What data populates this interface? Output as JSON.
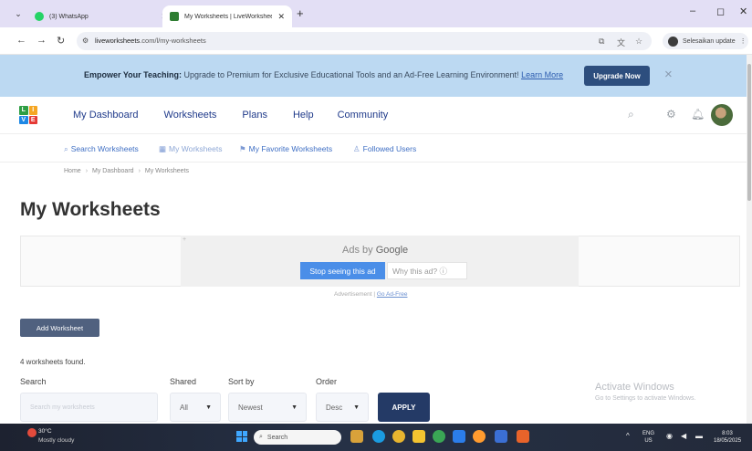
{
  "browser": {
    "tabs": [
      {
        "title": "(3) WhatsApp",
        "favicon_color": "#25d366",
        "active": false
      },
      {
        "title": "My Worksheets | LiveWorkshee",
        "favicon_color": "#2e7d32",
        "active": true
      }
    ],
    "new_tab": "+",
    "url_host": "liveworksheets",
    "url_rest": ".com/l/my-worksheets",
    "update_label": "Selesaikan update"
  },
  "promo": {
    "lead": "Empower Your Teaching:",
    "text": "Upgrade to Premium for Exclusive Educational Tools and an Ad-Free Learning Environment!",
    "learn_more": "Learn More",
    "button": "Upgrade Now",
    "close": "×"
  },
  "logo": {
    "letters": [
      "L",
      "I",
      "V",
      "E"
    ],
    "colors": [
      "#2e9e44",
      "#f5a623",
      "#1e88e5",
      "#e53935"
    ]
  },
  "nav": {
    "dashboard": "My Dashboard",
    "worksheets": "Worksheets",
    "plans": "Plans",
    "help": "Help",
    "community": "Community"
  },
  "subnav": {
    "search": "Search Worksheets",
    "mine": "My Worksheets",
    "favorites": "My Favorite Worksheets",
    "followed": "Followed Users"
  },
  "breadcrumb": {
    "home": "Home",
    "dashboard": "My Dashboard",
    "current": "My Worksheets"
  },
  "page_title": "My Worksheets",
  "ad": {
    "label_prefix": "Ads by",
    "label_brand": "Google",
    "stop": "Stop seeing this ad",
    "why": "Why this ad? ⓘ",
    "footer": "Advertisement |",
    "report": "Go Ad-Free"
  },
  "add_button": "Add Worksheet",
  "result_count": "4 worksheets found.",
  "filters": {
    "search_label": "Search",
    "search_placeholder": "Search my worksheets",
    "shared_label": "Shared",
    "shared_value": "All",
    "sort_label": "Sort by",
    "sort_value": "Newest",
    "order_label": "Order",
    "order_value": "Desc",
    "apply": "APPLY"
  },
  "watermark": {
    "line1": "Activate Windows",
    "line2": "Go to Settings to activate Windows."
  },
  "taskbar": {
    "weather_temp": "30°C",
    "weather_desc": "Mostly cloudy",
    "search": "Search",
    "lang1": "ENG",
    "lang2": "US",
    "time": "8:03",
    "date": "18/05/2025"
  }
}
